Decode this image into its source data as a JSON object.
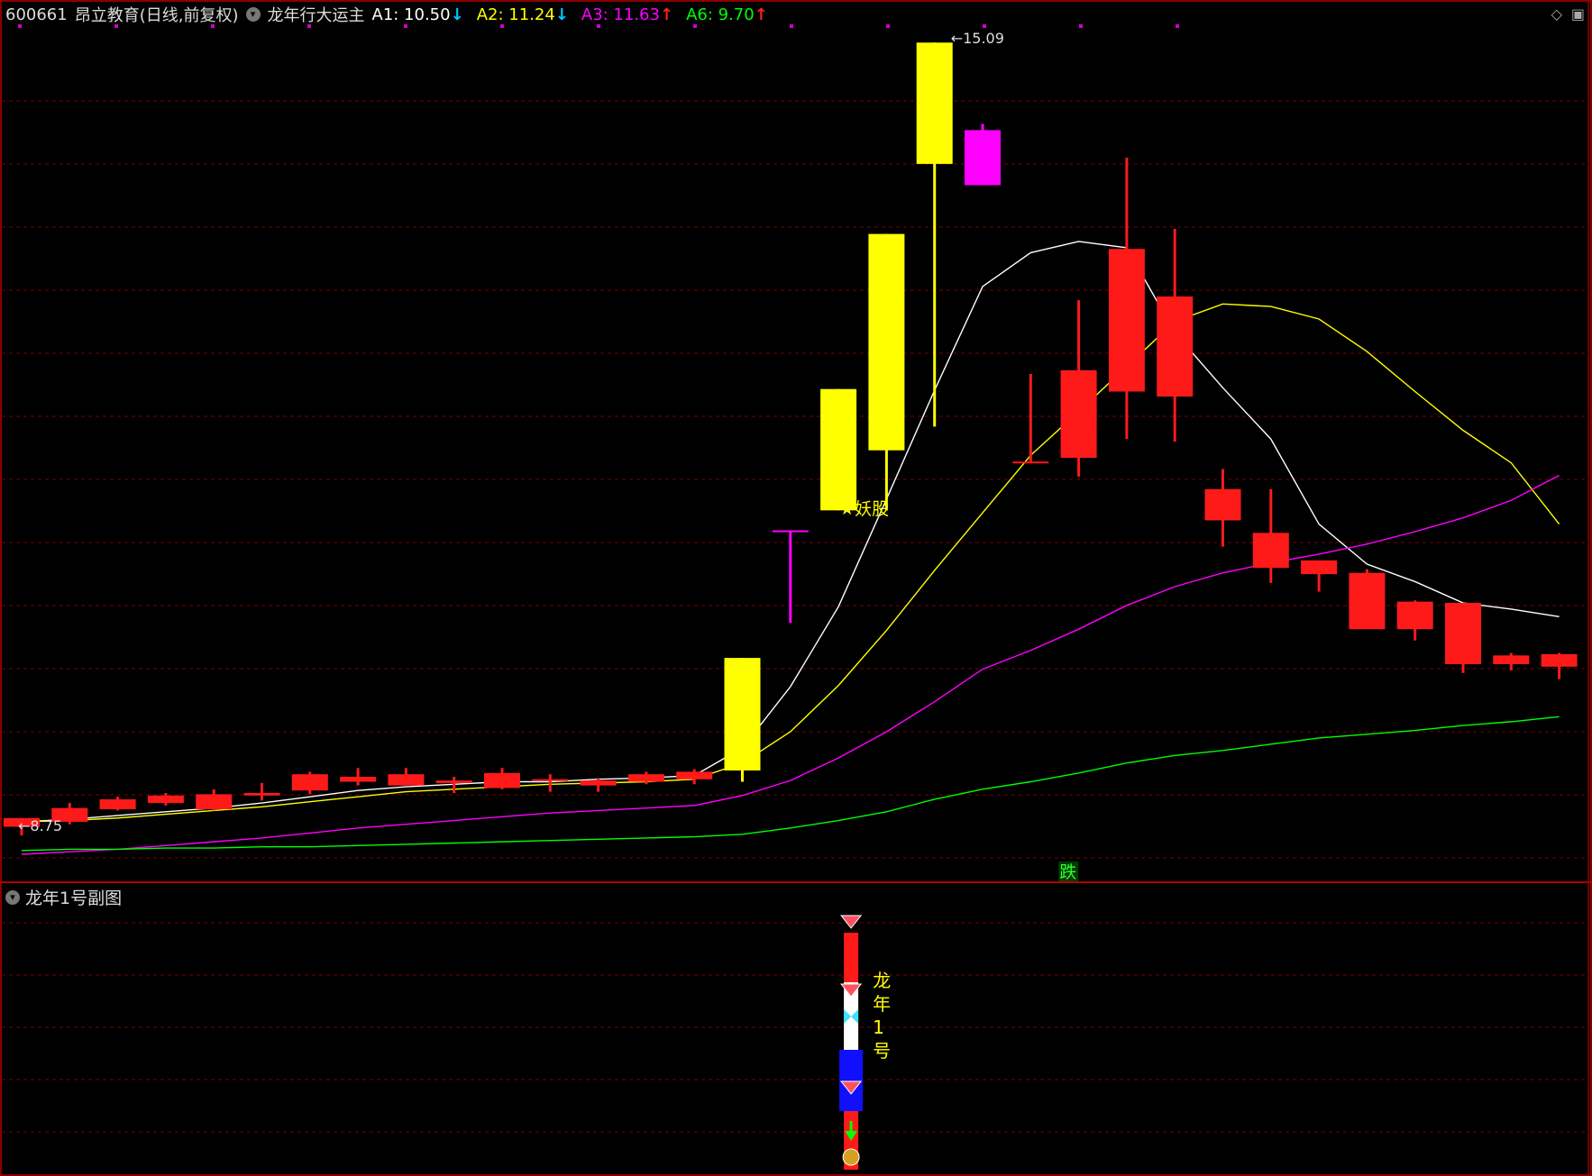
{
  "header": {
    "stock_code": "600661",
    "stock_name": "昂立教育(日线,前复权)",
    "indicator_name": "龙年行大运主",
    "items": [
      {
        "label": "A1: 10.50",
        "arrow": "↓",
        "color": "#ffffff",
        "arrow_color": "#00c8ff"
      },
      {
        "label": "A2: 11.24",
        "arrow": "↓",
        "color": "#ffff00",
        "arrow_color": "#00c8ff"
      },
      {
        "label": "A3: 11.63",
        "arrow": "↑",
        "color": "#ff00ff",
        "arrow_color": "#ff2020"
      },
      {
        "label": "A6: 9.70",
        "arrow": "↑",
        "color": "#00ff00",
        "arrow_color": "#ff2020"
      }
    ]
  },
  "sub_panel": {
    "title": "龙年1号副图"
  },
  "annotations": {
    "max_label": "15.09",
    "min_label": "8.75",
    "demon_label": "★妖股",
    "fall_label": "跌"
  },
  "sub_text": [
    "龙",
    "年",
    "1",
    "号"
  ],
  "chart_data": {
    "type": "candlestick",
    "title": "",
    "ylim": [
      8.6,
      15.2
    ],
    "grid": true,
    "candles": [
      {
        "o": 8.82,
        "h": 8.84,
        "l": 8.75,
        "c": 8.89,
        "color": "red"
      },
      {
        "o": 8.86,
        "h": 9.01,
        "l": 8.84,
        "c": 8.97,
        "color": "red"
      },
      {
        "o": 8.96,
        "h": 9.06,
        "l": 8.95,
        "c": 9.04,
        "color": "red"
      },
      {
        "o": 9.01,
        "h": 9.09,
        "l": 8.99,
        "c": 9.07,
        "color": "red"
      },
      {
        "o": 8.96,
        "h": 9.12,
        "l": 8.95,
        "c": 9.08,
        "color": "red"
      },
      {
        "o": 9.07,
        "h": 9.17,
        "l": 9.03,
        "c": 9.09,
        "color": "red"
      },
      {
        "o": 9.11,
        "h": 9.26,
        "l": 9.08,
        "c": 9.24,
        "color": "red"
      },
      {
        "o": 9.18,
        "h": 9.29,
        "l": 9.15,
        "c": 9.22,
        "color": "red"
      },
      {
        "o": 9.15,
        "h": 9.29,
        "l": 9.15,
        "c": 9.24,
        "color": "red"
      },
      {
        "o": 9.17,
        "h": 9.22,
        "l": 9.09,
        "c": 9.19,
        "color": "red"
      },
      {
        "o": 9.13,
        "h": 9.29,
        "l": 9.12,
        "c": 9.25,
        "color": "red"
      },
      {
        "o": 9.2,
        "h": 9.24,
        "l": 9.1,
        "c": 9.2,
        "color": "red"
      },
      {
        "o": 9.15,
        "h": 9.21,
        "l": 9.1,
        "c": 9.19,
        "color": "red"
      },
      {
        "o": 9.18,
        "h": 9.26,
        "l": 9.16,
        "c": 9.24,
        "color": "red"
      },
      {
        "o": 9.2,
        "h": 9.28,
        "l": 9.16,
        "c": 9.26,
        "color": "red"
      },
      {
        "o": 9.27,
        "h": 10.17,
        "l": 9.18,
        "c": 10.17,
        "color": "yellow"
      },
      {
        "o": 11.19,
        "h": 11.19,
        "l": 10.45,
        "c": 11.19,
        "color": "magenta"
      },
      {
        "o": 11.35,
        "h": 12.32,
        "l": 11.35,
        "c": 12.32,
        "color": "yellow"
      },
      {
        "o": 11.83,
        "h": 13.56,
        "l": 11.35,
        "c": 13.56,
        "color": "yellow"
      },
      {
        "o": 14.12,
        "h": 15.09,
        "l": 12.02,
        "c": 15.09,
        "color": "yellow"
      },
      {
        "o": 13.95,
        "h": 14.44,
        "l": 13.95,
        "c": 14.39,
        "color": "magenta"
      },
      {
        "o": 11.74,
        "h": 12.44,
        "l": 11.74,
        "c": 11.74,
        "color": "red"
      },
      {
        "o": 11.77,
        "h": 13.03,
        "l": 11.62,
        "c": 12.47,
        "color": "red"
      },
      {
        "o": 12.3,
        "h": 14.17,
        "l": 11.92,
        "c": 13.44,
        "color": "red"
      },
      {
        "o": 12.26,
        "h": 13.6,
        "l": 11.9,
        "c": 13.06,
        "color": "red"
      },
      {
        "o": 11.27,
        "h": 11.68,
        "l": 11.06,
        "c": 11.52,
        "color": "red"
      },
      {
        "o": 10.89,
        "h": 11.52,
        "l": 10.77,
        "c": 11.17,
        "color": "red"
      },
      {
        "o": 10.95,
        "h": 10.95,
        "l": 10.7,
        "c": 10.84,
        "color": "red"
      },
      {
        "o": 10.4,
        "h": 10.88,
        "l": 10.4,
        "c": 10.85,
        "color": "red"
      },
      {
        "o": 10.4,
        "h": 10.63,
        "l": 10.31,
        "c": 10.62,
        "color": "red"
      },
      {
        "o": 10.12,
        "h": 10.61,
        "l": 10.05,
        "c": 10.61,
        "color": "red"
      },
      {
        "o": 10.12,
        "h": 10.21,
        "l": 10.07,
        "c": 10.19,
        "color": "red"
      },
      {
        "o": 10.1,
        "h": 10.21,
        "l": 10.0,
        "c": 10.2,
        "color": "red"
      }
    ],
    "series": [
      {
        "name": "A1",
        "color": "#ffffff",
        "values": [
          8.86,
          8.88,
          8.91,
          8.94,
          8.97,
          9.01,
          9.06,
          9.11,
          9.14,
          9.16,
          9.18,
          9.18,
          9.2,
          9.21,
          9.23,
          9.45,
          9.94,
          10.58,
          11.44,
          12.31,
          13.14,
          13.41,
          13.5,
          13.45,
          12.77,
          12.33,
          11.92,
          11.24,
          10.92,
          10.78,
          10.61,
          10.56,
          10.5
        ]
      },
      {
        "name": "A2",
        "color": "#ffff00",
        "values": [
          8.86,
          8.87,
          8.89,
          8.92,
          8.95,
          8.98,
          9.02,
          9.06,
          9.1,
          9.12,
          9.14,
          9.16,
          9.17,
          9.18,
          9.2,
          9.33,
          9.58,
          9.95,
          10.39,
          10.87,
          11.33,
          11.79,
          12.14,
          12.5,
          12.86,
          13.0,
          12.98,
          12.88,
          12.62,
          12.3,
          11.99,
          11.73,
          11.24
        ]
      },
      {
        "name": "A3",
        "color": "#ff00ff",
        "values": [
          8.6,
          8.62,
          8.64,
          8.67,
          8.7,
          8.73,
          8.77,
          8.81,
          8.84,
          8.87,
          8.9,
          8.93,
          8.95,
          8.97,
          8.99,
          9.07,
          9.19,
          9.37,
          9.58,
          9.82,
          10.08,
          10.23,
          10.4,
          10.59,
          10.74,
          10.85,
          10.93,
          11.0,
          11.08,
          11.18,
          11.29,
          11.43,
          11.63
        ]
      },
      {
        "name": "A6",
        "color": "#00ff00",
        "values": [
          8.63,
          8.64,
          8.64,
          8.65,
          8.65,
          8.66,
          8.66,
          8.67,
          8.68,
          8.69,
          8.7,
          8.71,
          8.72,
          8.73,
          8.74,
          8.76,
          8.81,
          8.87,
          8.94,
          9.04,
          9.12,
          9.18,
          9.25,
          9.33,
          9.39,
          9.43,
          9.48,
          9.53,
          9.56,
          9.59,
          9.63,
          9.66,
          9.7
        ]
      }
    ]
  }
}
